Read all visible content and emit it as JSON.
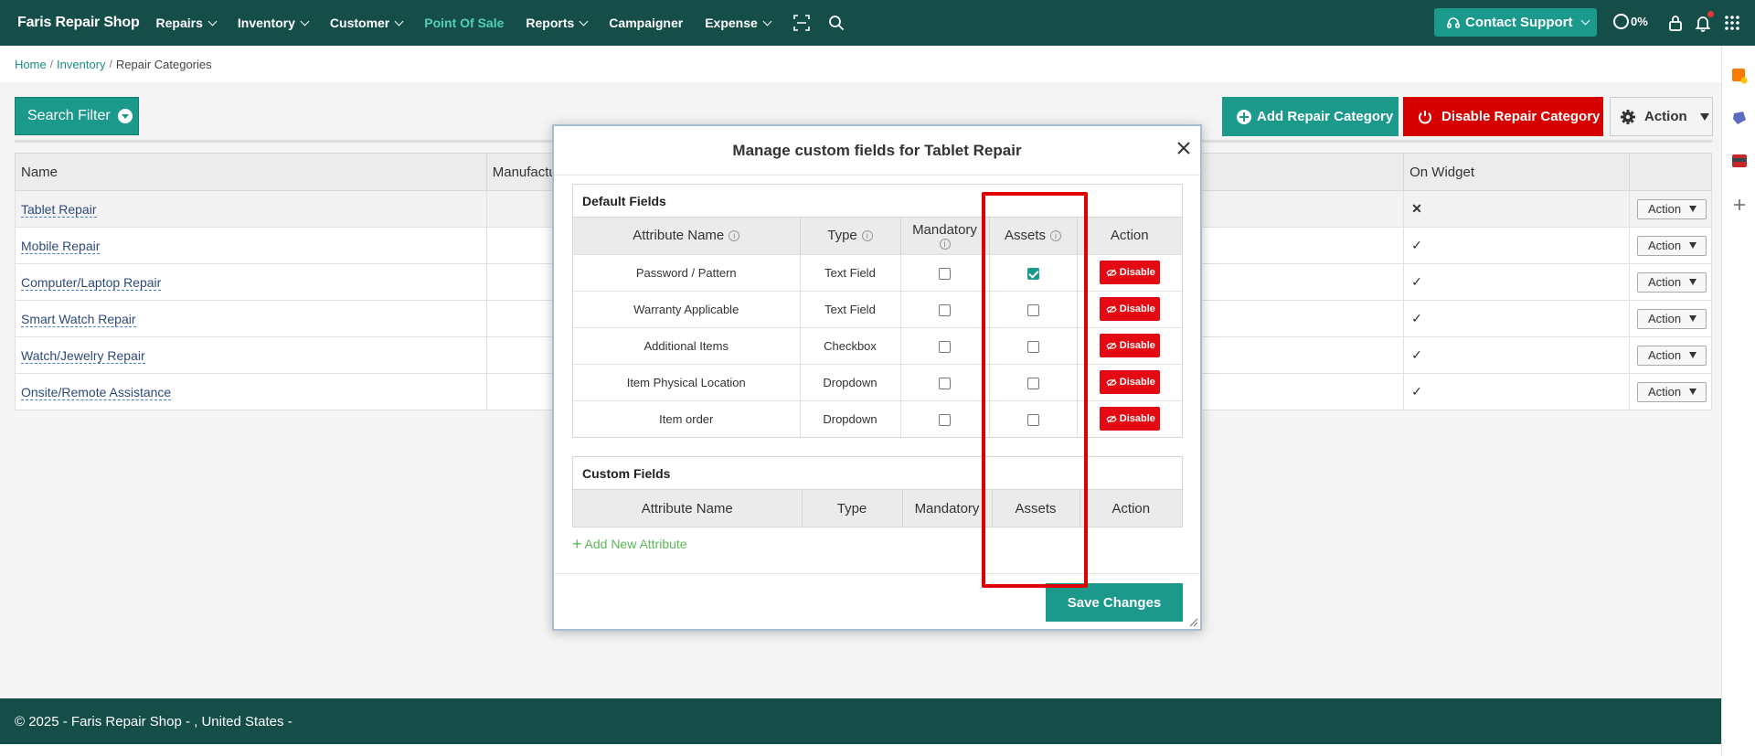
{
  "nav": {
    "brand": "Faris Repair Shop",
    "items": [
      {
        "label": "Repairs",
        "dropdown": true,
        "active": false
      },
      {
        "label": "Inventory",
        "dropdown": true,
        "active": false
      },
      {
        "label": "Customer",
        "dropdown": true,
        "active": false
      },
      {
        "label": "Point Of Sale",
        "dropdown": false,
        "active": true
      },
      {
        "label": "Reports",
        "dropdown": true,
        "active": false
      },
      {
        "label": "Campaigner",
        "dropdown": false,
        "active": false
      },
      {
        "label": "Expense",
        "dropdown": true,
        "active": false
      }
    ],
    "contact_support": "Contact Support",
    "progress": "0%",
    "colors": {
      "bar": "#154d48",
      "accent": "#1b998b",
      "active": "#4fd1b5"
    }
  },
  "breadcrumb": {
    "home": "Home",
    "inventory": "Inventory",
    "current": "Repair Categories"
  },
  "toolbar": {
    "search_filter": "Search Filter",
    "add_category": "Add Repair Category",
    "disable_category": "Disable Repair Category",
    "action": "Action"
  },
  "table": {
    "headers": {
      "name": "Name",
      "manufacturer": "Manufactu",
      "on_widget": "On Widget"
    },
    "action_label": "Action",
    "rows": [
      {
        "name": "Tablet Repair",
        "on_widget": "✕"
      },
      {
        "name": "Mobile Repair",
        "on_widget": "✓"
      },
      {
        "name": "Computer/Laptop Repair",
        "on_widget": "✓"
      },
      {
        "name": "Smart Watch Repair",
        "on_widget": "✓"
      },
      {
        "name": "Watch/Jewelry Repair",
        "on_widget": "✓"
      },
      {
        "name": "Onsite/Remote Assistance",
        "on_widget": "✓"
      }
    ]
  },
  "modal": {
    "title": "Manage custom fields for Tablet Repair",
    "default_section": "Default Fields",
    "custom_section": "Custom Fields",
    "headers": {
      "attribute": "Attribute Name",
      "type": "Type",
      "mandatory": "Mandatory",
      "assets": "Assets",
      "action": "Action"
    },
    "disable_label": "Disable",
    "fields": [
      {
        "name": "Password / Pattern",
        "type": "Text Field",
        "mandatory": false,
        "assets": true
      },
      {
        "name": "Warranty Applicable",
        "type": "Text Field",
        "mandatory": false,
        "assets": false
      },
      {
        "name": "Additional Items",
        "type": "Checkbox",
        "mandatory": false,
        "assets": false
      },
      {
        "name": "Item Physical Location",
        "type": "Dropdown",
        "mandatory": false,
        "assets": false
      },
      {
        "name": "Item order",
        "type": "Dropdown",
        "mandatory": false,
        "assets": false
      }
    ],
    "add_attribute": "Add New Attribute",
    "save": "Save Changes"
  },
  "footer": {
    "text": "© 2025 - Faris Repair Shop - , United States -"
  }
}
